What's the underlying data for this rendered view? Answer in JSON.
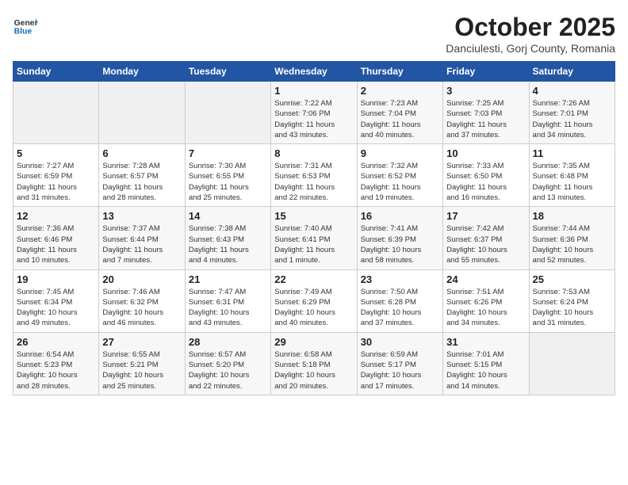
{
  "header": {
    "logo_line1": "General",
    "logo_line2": "Blue",
    "title": "October 2025",
    "subtitle": "Danciulesti, Gorj County, Romania"
  },
  "weekdays": [
    "Sunday",
    "Monday",
    "Tuesday",
    "Wednesday",
    "Thursday",
    "Friday",
    "Saturday"
  ],
  "weeks": [
    [
      {
        "day": "",
        "info": ""
      },
      {
        "day": "",
        "info": ""
      },
      {
        "day": "",
        "info": ""
      },
      {
        "day": "1",
        "info": "Sunrise: 7:22 AM\nSunset: 7:06 PM\nDaylight: 11 hours\nand 43 minutes."
      },
      {
        "day": "2",
        "info": "Sunrise: 7:23 AM\nSunset: 7:04 PM\nDaylight: 11 hours\nand 40 minutes."
      },
      {
        "day": "3",
        "info": "Sunrise: 7:25 AM\nSunset: 7:03 PM\nDaylight: 11 hours\nand 37 minutes."
      },
      {
        "day": "4",
        "info": "Sunrise: 7:26 AM\nSunset: 7:01 PM\nDaylight: 11 hours\nand 34 minutes."
      }
    ],
    [
      {
        "day": "5",
        "info": "Sunrise: 7:27 AM\nSunset: 6:59 PM\nDaylight: 11 hours\nand 31 minutes."
      },
      {
        "day": "6",
        "info": "Sunrise: 7:28 AM\nSunset: 6:57 PM\nDaylight: 11 hours\nand 28 minutes."
      },
      {
        "day": "7",
        "info": "Sunrise: 7:30 AM\nSunset: 6:55 PM\nDaylight: 11 hours\nand 25 minutes."
      },
      {
        "day": "8",
        "info": "Sunrise: 7:31 AM\nSunset: 6:53 PM\nDaylight: 11 hours\nand 22 minutes."
      },
      {
        "day": "9",
        "info": "Sunrise: 7:32 AM\nSunset: 6:52 PM\nDaylight: 11 hours\nand 19 minutes."
      },
      {
        "day": "10",
        "info": "Sunrise: 7:33 AM\nSunset: 6:50 PM\nDaylight: 11 hours\nand 16 minutes."
      },
      {
        "day": "11",
        "info": "Sunrise: 7:35 AM\nSunset: 6:48 PM\nDaylight: 11 hours\nand 13 minutes."
      }
    ],
    [
      {
        "day": "12",
        "info": "Sunrise: 7:36 AM\nSunset: 6:46 PM\nDaylight: 11 hours\nand 10 minutes."
      },
      {
        "day": "13",
        "info": "Sunrise: 7:37 AM\nSunset: 6:44 PM\nDaylight: 11 hours\nand 7 minutes."
      },
      {
        "day": "14",
        "info": "Sunrise: 7:38 AM\nSunset: 6:43 PM\nDaylight: 11 hours\nand 4 minutes."
      },
      {
        "day": "15",
        "info": "Sunrise: 7:40 AM\nSunset: 6:41 PM\nDaylight: 11 hours\nand 1 minute."
      },
      {
        "day": "16",
        "info": "Sunrise: 7:41 AM\nSunset: 6:39 PM\nDaylight: 10 hours\nand 58 minutes."
      },
      {
        "day": "17",
        "info": "Sunrise: 7:42 AM\nSunset: 6:37 PM\nDaylight: 10 hours\nand 55 minutes."
      },
      {
        "day": "18",
        "info": "Sunrise: 7:44 AM\nSunset: 6:36 PM\nDaylight: 10 hours\nand 52 minutes."
      }
    ],
    [
      {
        "day": "19",
        "info": "Sunrise: 7:45 AM\nSunset: 6:34 PM\nDaylight: 10 hours\nand 49 minutes."
      },
      {
        "day": "20",
        "info": "Sunrise: 7:46 AM\nSunset: 6:32 PM\nDaylight: 10 hours\nand 46 minutes."
      },
      {
        "day": "21",
        "info": "Sunrise: 7:47 AM\nSunset: 6:31 PM\nDaylight: 10 hours\nand 43 minutes."
      },
      {
        "day": "22",
        "info": "Sunrise: 7:49 AM\nSunset: 6:29 PM\nDaylight: 10 hours\nand 40 minutes."
      },
      {
        "day": "23",
        "info": "Sunrise: 7:50 AM\nSunset: 6:28 PM\nDaylight: 10 hours\nand 37 minutes."
      },
      {
        "day": "24",
        "info": "Sunrise: 7:51 AM\nSunset: 6:26 PM\nDaylight: 10 hours\nand 34 minutes."
      },
      {
        "day": "25",
        "info": "Sunrise: 7:53 AM\nSunset: 6:24 PM\nDaylight: 10 hours\nand 31 minutes."
      }
    ],
    [
      {
        "day": "26",
        "info": "Sunrise: 6:54 AM\nSunset: 5:23 PM\nDaylight: 10 hours\nand 28 minutes."
      },
      {
        "day": "27",
        "info": "Sunrise: 6:55 AM\nSunset: 5:21 PM\nDaylight: 10 hours\nand 25 minutes."
      },
      {
        "day": "28",
        "info": "Sunrise: 6:57 AM\nSunset: 5:20 PM\nDaylight: 10 hours\nand 22 minutes."
      },
      {
        "day": "29",
        "info": "Sunrise: 6:58 AM\nSunset: 5:18 PM\nDaylight: 10 hours\nand 20 minutes."
      },
      {
        "day": "30",
        "info": "Sunrise: 6:59 AM\nSunset: 5:17 PM\nDaylight: 10 hours\nand 17 minutes."
      },
      {
        "day": "31",
        "info": "Sunrise: 7:01 AM\nSunset: 5:15 PM\nDaylight: 10 hours\nand 14 minutes."
      },
      {
        "day": "",
        "info": ""
      }
    ]
  ]
}
